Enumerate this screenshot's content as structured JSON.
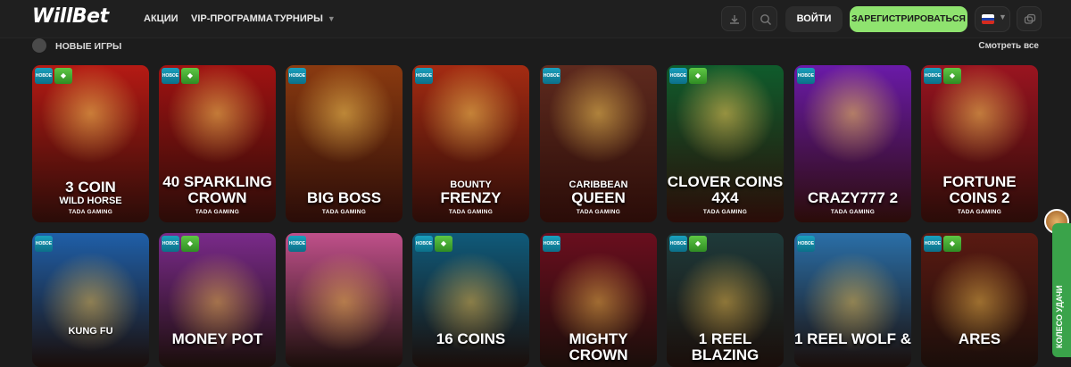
{
  "header": {
    "logo": "WillBet",
    "nav": [
      {
        "label": "АКЦИИ"
      },
      {
        "label": "VIP-ПРОГРАММА"
      },
      {
        "label": "ТУРНИРЫ"
      }
    ],
    "login_label": "ВОЙТИ",
    "register_label": "ЗАРЕГИСТРИРОВАТЬСЯ",
    "icons": [
      "download-icon",
      "search-icon",
      "flag-ru-icon",
      "chevron-down-icon",
      "chat-icon"
    ]
  },
  "section": {
    "title": "НОВЫЕ ИГРЫ",
    "see_all": "Смотреть все"
  },
  "badges": {
    "new": "НОВОЕ",
    "gem": "◆"
  },
  "games_row1": [
    {
      "small": "",
      "big": "3 COIN",
      "sub": "WILD HORSE",
      "provider": "TADA GAMING",
      "color": "#b51a14",
      "badges": [
        "new",
        "gem"
      ]
    },
    {
      "small": "",
      "big": "40 SPARKLING CROWN",
      "sub": "",
      "provider": "TADA GAMING",
      "color": "#a01212",
      "badges": [
        "new",
        "gem"
      ]
    },
    {
      "small": "",
      "big": "BIG BOSS",
      "sub": "",
      "provider": "TADA GAMING",
      "color": "#8a3a10",
      "badges": [
        "new"
      ]
    },
    {
      "small": "BOUNTY",
      "big": "FRENZY",
      "sub": "",
      "provider": "TADA GAMING",
      "color": "#a42b12",
      "badges": [
        "new"
      ]
    },
    {
      "small": "CARIBBEAN",
      "big": "QUEEN",
      "sub": "",
      "provider": "TADA GAMING",
      "color": "#5e2a1e",
      "badges": [
        "new"
      ]
    },
    {
      "small": "",
      "big": "CLOVER COINS 4X4",
      "sub": "",
      "provider": "TADA GAMING",
      "color": "#0f5c2c",
      "badges": [
        "new",
        "gem"
      ]
    },
    {
      "small": "",
      "big": "CRAZY777 2",
      "sub": "",
      "provider": "TADA GAMING",
      "color": "#6a1aa8",
      "badges": [
        "new"
      ]
    },
    {
      "small": "",
      "big": "FORTUNE COINS 2",
      "sub": "",
      "provider": "TADA GAMING",
      "color": "#9a1420",
      "badges": [
        "new",
        "gem"
      ]
    }
  ],
  "games_row2": [
    {
      "big": "KUNG FU",
      "small_title": true,
      "color": "#1f5fa8",
      "badges": [
        "new"
      ]
    },
    {
      "big": "MONEY POT",
      "small_title": false,
      "color": "#7a2a8a",
      "badges": [
        "new",
        "gem"
      ]
    },
    {
      "big": "",
      "small_title": false,
      "color": "#c0508a",
      "badges": [
        "new"
      ]
    },
    {
      "big": "16 COINS",
      "small_title": false,
      "color": "#0f5a7a",
      "badges": [
        "new",
        "gem"
      ]
    },
    {
      "big": "MIGHTY CROWN",
      "small_title": false,
      "color": "#6a0e1e",
      "badges": [
        "new"
      ]
    },
    {
      "big": "1 REEL BLAZING",
      "small_title": false,
      "color": "#1e3a3a",
      "badges": [
        "new",
        "gem"
      ]
    },
    {
      "big": "1 REEL WOLF &",
      "small_title": false,
      "color": "#2a6fa8",
      "badges": [
        "new"
      ]
    },
    {
      "big": "ARES",
      "small_title": false,
      "color": "#5a1a12",
      "badges": [
        "new",
        "gem"
      ]
    }
  ],
  "wheel_label": "КОЛЕСО УДАЧИ"
}
